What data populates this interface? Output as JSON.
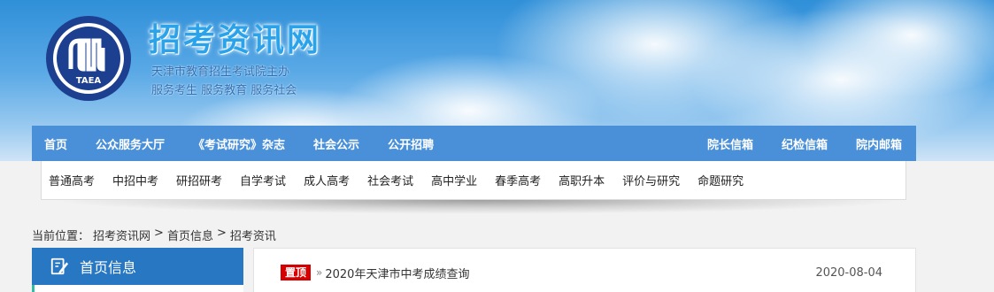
{
  "header": {
    "site_title": "招考资讯网",
    "subtitle_1": "天津市教育招生考试院主办",
    "subtitle_2": "服务考生 服务教育 服务社会",
    "logo_text": "TAEA",
    "logo_icon": "taea-seal-logo"
  },
  "main_nav": {
    "left_items": [
      {
        "label": "首页"
      },
      {
        "label": "公众服务大厅"
      },
      {
        "label": "《考试研究》杂志"
      },
      {
        "label": "社会公示"
      },
      {
        "label": "公开招聘"
      }
    ],
    "right_items": [
      {
        "label": "院长信箱"
      },
      {
        "label": "纪检信箱"
      },
      {
        "label": "院内邮箱"
      }
    ],
    "color": "#4a90d9"
  },
  "sub_nav": {
    "items": [
      {
        "label": "普通高考"
      },
      {
        "label": "中招中考"
      },
      {
        "label": "研招研考"
      },
      {
        "label": "自学考试"
      },
      {
        "label": "成人高考"
      },
      {
        "label": "社会考试"
      },
      {
        "label": "高中学业"
      },
      {
        "label": "春季高考"
      },
      {
        "label": "高职升本"
      },
      {
        "label": "评价与研究"
      },
      {
        "label": "命题研究"
      }
    ]
  },
  "breadcrumb": {
    "prefix": "当前位置：",
    "items": [
      "招考资讯网",
      "首页信息",
      "招考资讯"
    ],
    "separator": ">"
  },
  "sidebar": {
    "title": "首页信息",
    "icon": "edit-document-icon",
    "color": "#2877c2"
  },
  "news": {
    "items": [
      {
        "badge": "置顶",
        "title": "2020年天津市中考成绩查询",
        "date": "2020-08-04"
      }
    ],
    "badge_color": "#d60000"
  }
}
